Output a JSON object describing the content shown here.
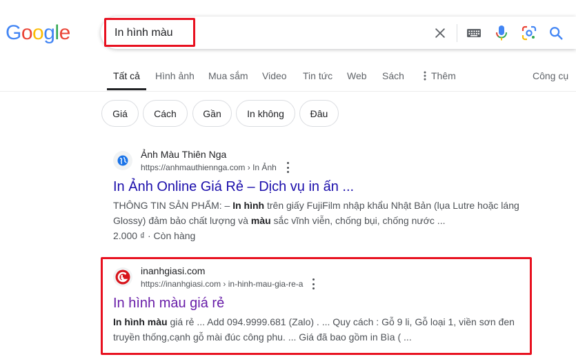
{
  "logo": {
    "letters": [
      "G",
      "o",
      "o",
      "g",
      "l",
      "e"
    ],
    "colors": [
      "#4285f4",
      "#ea4335",
      "#fbbc05",
      "#4285f4",
      "#34a853",
      "#ea4335"
    ]
  },
  "search": {
    "query": "In hình màu",
    "clear_icon": "close-icon",
    "keyboard_icon": "keyboard-icon",
    "mic_icon": "microphone-icon",
    "lens_icon": "lens-icon",
    "search_icon": "search-icon"
  },
  "tabs": [
    {
      "label": "Tất cả",
      "active": true
    },
    {
      "label": "Hình ảnh"
    },
    {
      "label": "Mua sắm"
    },
    {
      "label": "Video"
    },
    {
      "label": "Tin tức"
    },
    {
      "label": "Web"
    },
    {
      "label": "Sách"
    },
    {
      "label": "Thêm"
    }
  ],
  "tools_label": "Công cụ",
  "chips": [
    "Giá",
    "Cách",
    "Gần",
    "In không",
    "Đâu"
  ],
  "results": [
    {
      "site_name": "Ảnh Màu Thiên Nga",
      "url": "https://anhmauthiennga.com › In Ảnh",
      "title": "In Ảnh Online Giá Rẻ – Dịch vụ in ấn ...",
      "snippet_parts": [
        {
          "text": "THÔNG TIN SẢN PHẨM: – "
        },
        {
          "text": "In hình",
          "bold": true
        },
        {
          "text": " trên giấy FujiFilm nhập khẩu Nhật Bản (lụa Lutre hoặc láng Glossy) đảm bảo chất lượng và "
        },
        {
          "text": "màu",
          "bold": true
        },
        {
          "text": " sắc vĩnh viễn, chống bụi, chống nước ..."
        }
      ],
      "meta": "2.000 ₫ · Còn hàng",
      "favicon": "globe-icon"
    },
    {
      "site_name": "inanhgiasi.com",
      "url": "https://inanhgiasi.com › in-hinh-mau-gia-re-a",
      "title": "In hình màu giá rẻ",
      "snippet_parts": [
        {
          "text": "In hình màu",
          "bold": true
        },
        {
          "text": " giá rẻ ... Add 094.9999.681 (Zalo) . ... Quy cách : Gỗ 9 li, Gỗ loại 1, viền sơn đen truyền thống,cạnh gỗ mài đúc công phu. ... Giá đã bao gồm in Bìa ( ..."
        }
      ],
      "favicon": "inanhgiasi-logo-icon"
    }
  ],
  "colors": {
    "link": "#1a0dab",
    "visited": "#681da8",
    "highlight": "#e8101f"
  }
}
